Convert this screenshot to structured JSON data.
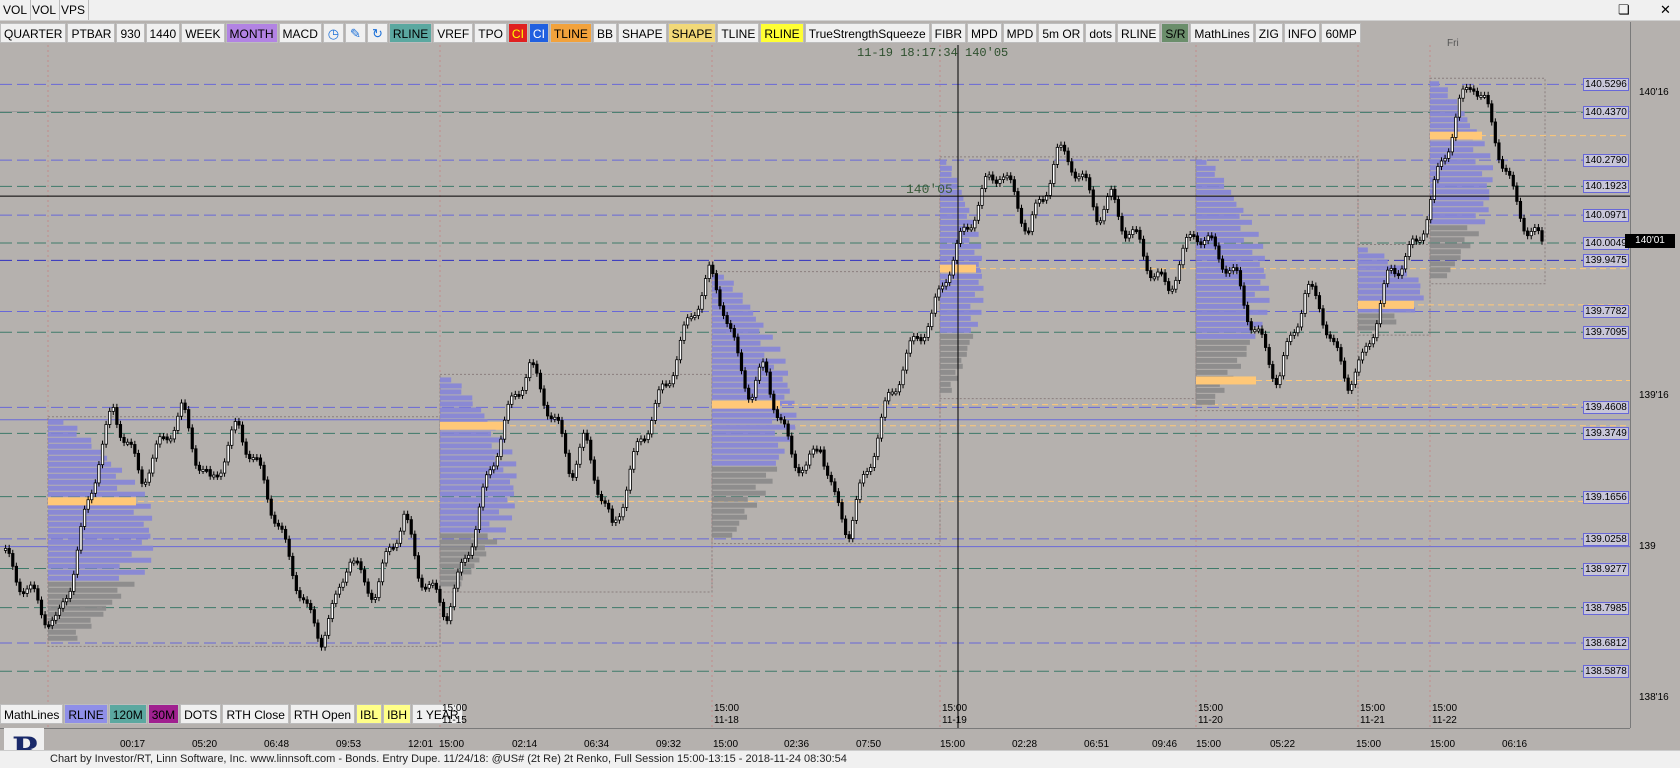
{
  "menubar": {
    "items": [
      "VOL",
      "VOL",
      "VPS"
    ]
  },
  "window_controls": {
    "restore_icon": "restore-icon",
    "close_icon": "close-icon"
  },
  "toolbar_top": {
    "buttons": [
      {
        "label": "QUARTER",
        "bg": "#f0f0f0"
      },
      {
        "label": "PTBAR",
        "bg": "#f0f0f0"
      },
      {
        "label": "930",
        "bg": "#f0f0f0"
      },
      {
        "label": "1440",
        "bg": "#f0f0f0"
      },
      {
        "label": "WEEK",
        "bg": "#f0f0f0"
      },
      {
        "label": "MONTH",
        "bg": "#b283e3"
      },
      {
        "label": "MACD",
        "bg": "#f0f0f0"
      },
      {
        "label": "",
        "icon": "clock-icon",
        "bg": "#f0f0f0"
      },
      {
        "label": "",
        "icon": "pencil-icon",
        "bg": "#f0f0f0"
      },
      {
        "label": "",
        "icon": "refresh-icon",
        "bg": "#f0f0f0"
      },
      {
        "label": "RLINE",
        "bg": "#5ba8a0"
      },
      {
        "label": "VREF",
        "bg": "#f0f0f0"
      },
      {
        "label": "TPO",
        "bg": "#f0f0f0"
      },
      {
        "label": "CI",
        "bg": "#e02020",
        "color": "#ffff00"
      },
      {
        "label": "CI",
        "bg": "#2060e0",
        "color": "#ffffff"
      },
      {
        "label": "TLINE",
        "bg": "#f2a23c"
      },
      {
        "label": "BB",
        "bg": "#f0f0f0"
      },
      {
        "label": "SHAPE",
        "bg": "#f0f0f0"
      },
      {
        "label": "SHAPE",
        "bg": "#f2d978"
      },
      {
        "label": "TLINE",
        "bg": "#f0f0f0"
      },
      {
        "label": "RLINE",
        "bg": "#ffff33"
      },
      {
        "label": "TrueStrengthSqueeze",
        "bg": "#f0f0f0"
      },
      {
        "label": "FIBR",
        "bg": "#f0f0f0"
      },
      {
        "label": "MPD",
        "bg": "#f0f0f0"
      },
      {
        "label": "MPD",
        "bg": "#f0f0f0"
      },
      {
        "label": "5m OR",
        "bg": "#f0f0f0"
      },
      {
        "label": "dots",
        "bg": "#f0f0f0"
      },
      {
        "label": "RLINE",
        "bg": "#f0f0f0"
      },
      {
        "label": "S/R",
        "bg": "#6b8e6b"
      },
      {
        "label": "MathLines",
        "bg": "#f0f0f0"
      },
      {
        "label": "ZIG",
        "bg": "#f0f0f0"
      },
      {
        "label": "INFO",
        "bg": "#f0f0f0"
      },
      {
        "label": "60MP",
        "bg": "#f0f0f0"
      }
    ]
  },
  "toolbar_bottom": {
    "buttons": [
      {
        "label": "MathLines",
        "bg": "#f0f0f0"
      },
      {
        "label": "RLINE",
        "bg": "#8f8fe8"
      },
      {
        "label": "120M",
        "bg": "#5ba8a0"
      },
      {
        "label": "30M",
        "bg": "#a0208f"
      },
      {
        "label": "DOTS",
        "bg": "#f0f0f0"
      },
      {
        "label": "RTH Close",
        "bg": "#f0f0f0"
      },
      {
        "label": "RTH Open",
        "bg": "#f0f0f0"
      },
      {
        "label": "IBL",
        "bg": "#ffff88"
      },
      {
        "label": "IBH",
        "bg": "#ffff88"
      },
      {
        "label": "1 YEAR",
        "bg": "#f0f0f0"
      }
    ]
  },
  "readout": {
    "text": "11-19 18:17:34 140'05"
  },
  "crosshair_price_label": "140'05",
  "current_price_label": "140'01",
  "day_labels": [
    "Fri"
  ],
  "chart_data": {
    "type": "candlestick-renko",
    "symbol": "@US# (2t Re) 2t Renko",
    "price_levels": [
      {
        "value": "140.5296",
        "color": "#6868d8"
      },
      {
        "value": "140.4370",
        "color": "#3e7a6a"
      },
      {
        "value": "140.2790",
        "color": "#6868d8"
      },
      {
        "value": "140.1923",
        "color": "#3e7a6a"
      },
      {
        "value": "140.0971",
        "color": "#6868d8"
      },
      {
        "value": "140.0049",
        "color": "#3e7a6a"
      },
      {
        "value": "139.9475",
        "color": "#3030c0"
      },
      {
        "value": "139.7782",
        "color": "#6868d8"
      },
      {
        "value": "139.7095",
        "color": "#3e7a6a"
      },
      {
        "value": "139.4608",
        "color": "#6868d8"
      },
      {
        "value": "139.3749",
        "color": "#3e7a6a"
      },
      {
        "value": "139.1656",
        "color": "#3e7a6a"
      },
      {
        "value": "139.0258",
        "color": "#6868d8"
      },
      {
        "value": "138.9277",
        "color": "#3e7a6a"
      },
      {
        "value": "138.7985",
        "color": "#3e7a6a"
      },
      {
        "value": "138.6812",
        "color": "#6868d8"
      },
      {
        "value": "138.5878",
        "color": "#3e7a6a"
      }
    ],
    "axis_ticks": [
      "140'16",
      "139'16",
      "139",
      "138'16"
    ],
    "time_ticks_top": [
      "15:00",
      "15:00",
      "15:00",
      "15:00",
      "15:00",
      "15:00"
    ],
    "date_ticks": [
      "11-15",
      "11-18",
      "11-19",
      "11-20",
      "11-21",
      "11-22"
    ],
    "time_ticks": [
      "00:17",
      "05:20",
      "06:48",
      "09:53",
      "12:01",
      "15:00",
      "02:14",
      "06:34",
      "09:32",
      "15:00",
      "02:36",
      "07:50",
      "15:00",
      "02:28",
      "06:51",
      "09:46",
      "15:00",
      "05:22",
      "15:00",
      "15:00",
      "06:16"
    ],
    "price_path": [
      138.99,
      138.9,
      138.85,
      138.78,
      138.74,
      138.9,
      139.1,
      139.3,
      139.45,
      139.35,
      139.22,
      139.3,
      139.38,
      139.45,
      139.3,
      139.2,
      139.3,
      139.4,
      139.3,
      139.2,
      139.05,
      138.92,
      138.78,
      138.7,
      138.8,
      138.98,
      138.88,
      138.85,
      139.0,
      139.1,
      138.92,
      138.85,
      138.78,
      138.9,
      139.05,
      139.22,
      139.38,
      139.5,
      139.6,
      139.5,
      139.4,
      139.25,
      139.35,
      139.2,
      139.05,
      139.2,
      139.35,
      139.45,
      139.55,
      139.68,
      139.8,
      139.9,
      139.8,
      139.62,
      139.5,
      139.6,
      139.42,
      139.3,
      139.25,
      139.35,
      139.15,
      139.05,
      139.2,
      139.35,
      139.5,
      139.6,
      139.7,
      139.75,
      139.9,
      140.0,
      140.1,
      140.2,
      140.25,
      140.15,
      140.05,
      140.15,
      140.3,
      140.28,
      140.2,
      140.1,
      140.15,
      140.05,
      140.0,
      139.9,
      139.85,
      139.95,
      140.05,
      140.0,
      139.95,
      139.88,
      139.75,
      139.65,
      139.55,
      139.7,
      139.85,
      139.8,
      139.65,
      139.55,
      139.6,
      139.75,
      139.9,
      139.95,
      140.0,
      140.15,
      140.3,
      140.45,
      140.55,
      140.45,
      140.3,
      140.15,
      140.05,
      140.0
    ]
  },
  "status": {
    "text": "Chart by Investor/RT, Linn Software, Inc. www.linnsoft.com - Bonds. Entry Dupe.   11/24/18: @US# (2t Re) 2t Renko, Full Session 15:00-13:15 - 2018-11-24 08:30:54"
  },
  "colors": {
    "background": "#b5b1ae",
    "candle_up": "#000000",
    "candle_down": "#000000",
    "profile_blue": "#8585d8",
    "profile_gray": "#8a8a8a",
    "poc_orange": "#ffc878",
    "session_box": "#8a7f7f"
  }
}
